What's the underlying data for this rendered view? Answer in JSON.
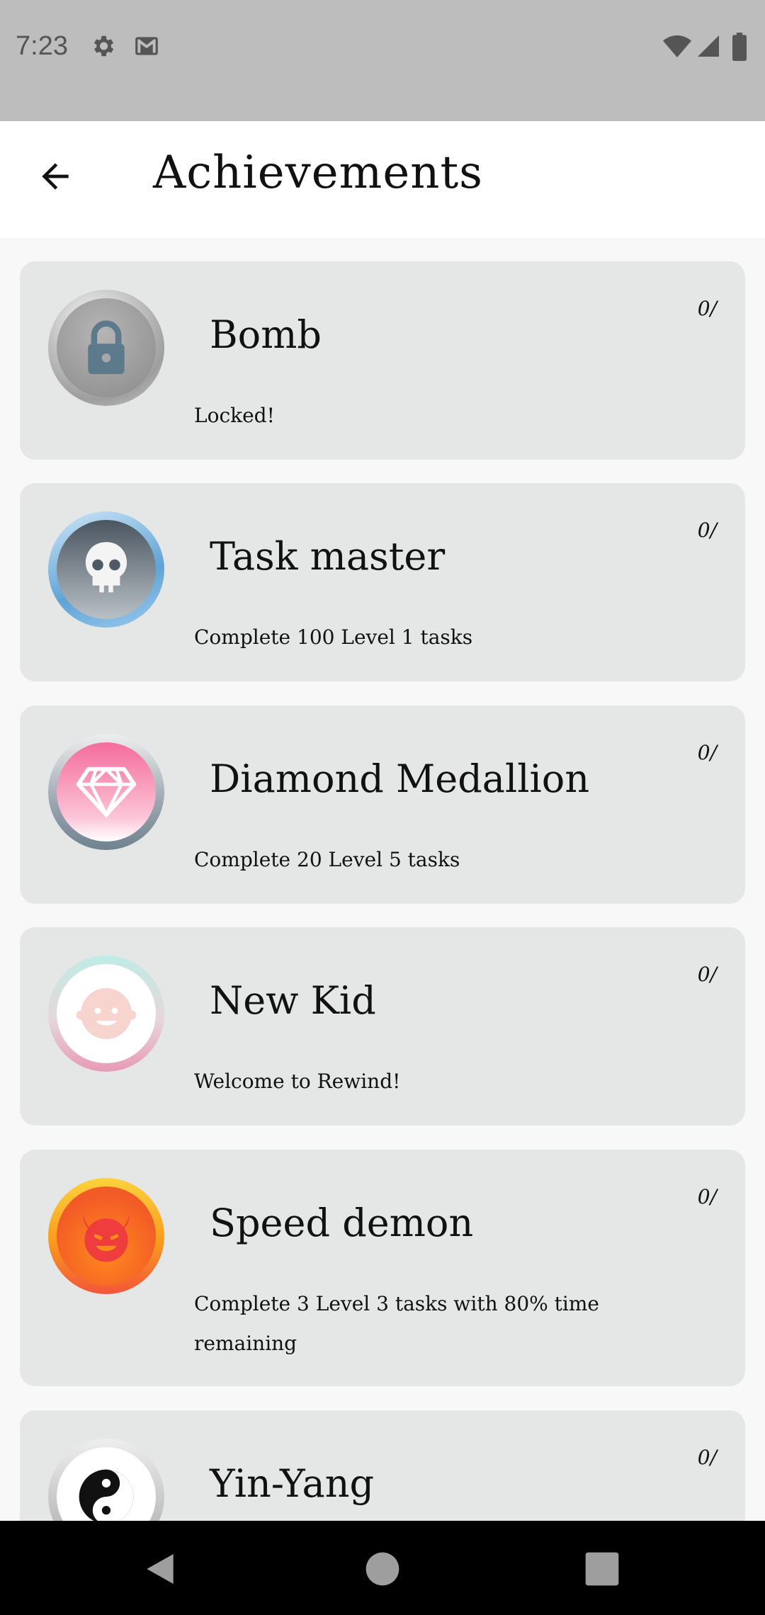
{
  "status_bar": {
    "time": "7:23",
    "left_icons": [
      "gear-icon",
      "gmail-icon"
    ],
    "right_icons": [
      "wifi-icon",
      "signal-icon",
      "battery-icon"
    ]
  },
  "app_bar": {
    "back_icon": "arrow-back-icon",
    "title": "Achievements"
  },
  "achievements": [
    {
      "title": "Bomb",
      "description": "Locked!",
      "count": "0/",
      "icon": "lock-icon"
    },
    {
      "title": "Task master",
      "description": "Complete 100 Level 1 tasks",
      "count": "0/",
      "icon": "skull-icon"
    },
    {
      "title": "Diamond Medallion",
      "description": "Complete 20 Level 5 tasks",
      "count": "0/",
      "icon": "diamond-icon"
    },
    {
      "title": "New Kid",
      "description": "Welcome to Rewind!",
      "count": "0/",
      "icon": "baby-face-icon"
    },
    {
      "title": "Speed demon",
      "description": "Complete 3 Level 3 tasks with 80% time remaining",
      "count": "0/",
      "icon": "devil-face-icon"
    },
    {
      "title": "Yin-Yang",
      "description": "",
      "count": "0/",
      "icon": "yin-yang-icon"
    }
  ],
  "nav_bar": {
    "back": "nav-back-icon",
    "home": "nav-home-icon",
    "recents": "nav-recents-icon"
  },
  "colors": {
    "status_bar": "#bdbdbd",
    "card": "#e5e6e6",
    "background": "#f8f8f8"
  }
}
